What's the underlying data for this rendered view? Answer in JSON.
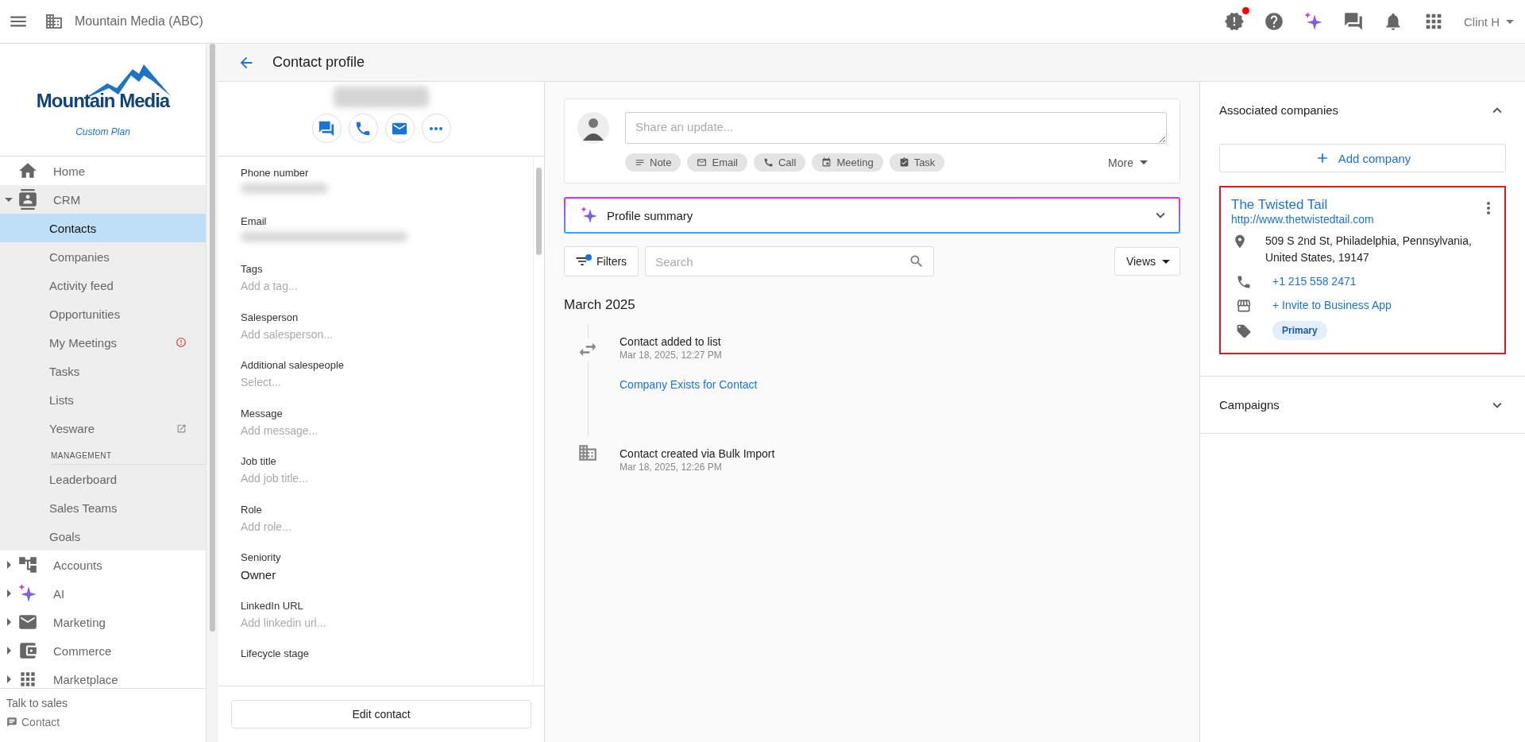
{
  "top_bar": {
    "account": "Mountain Media (ABC)",
    "notification_dot": true,
    "user": "Clint H"
  },
  "sidebar": {
    "logo": "Mountain Media",
    "plan": "Custom Plan",
    "items": [
      {
        "label": "Home"
      },
      {
        "label": "CRM",
        "expanded": true,
        "children": [
          {
            "kind": "link",
            "label": "Contacts",
            "selected": true
          },
          {
            "kind": "link",
            "label": "Companies",
            "selected": false
          },
          {
            "kind": "link",
            "label": "Activity feed",
            "selected": false
          },
          {
            "kind": "link",
            "label": "Opportunities",
            "selected": false
          },
          {
            "kind": "alert",
            "label": "My Meetings",
            "selected": false
          },
          {
            "kind": "link",
            "label": "Tasks",
            "selected": false
          },
          {
            "kind": "link",
            "label": "Lists",
            "selected": false
          },
          {
            "kind": "external",
            "label": "Yesware",
            "selected": false
          },
          {
            "kind": "heading",
            "label": "MANAGEMENT"
          },
          {
            "kind": "link",
            "label": "Leaderboard",
            "selected": false
          },
          {
            "kind": "link",
            "label": "Sales Teams",
            "selected": false
          },
          {
            "kind": "link",
            "label": "Goals",
            "selected": false
          }
        ]
      },
      {
        "label": "Accounts",
        "expanded": false
      },
      {
        "label": "AI",
        "expanded": false
      },
      {
        "label": "Marketing",
        "expanded": false
      },
      {
        "label": "Commerce",
        "expanded": false
      },
      {
        "label": "Marketplace",
        "expanded": false
      }
    ],
    "footer_title": "Talk to sales",
    "footer_link": "Contact"
  },
  "page": {
    "title": "Contact profile"
  },
  "profile": {
    "fields": [
      {
        "label": "Phone number",
        "kind": "blurred"
      },
      {
        "label": "Email",
        "kind": "blurred"
      },
      {
        "label": "Tags",
        "kind": "empty",
        "placeholder": "Add a tag..."
      },
      {
        "label": "Salesperson",
        "kind": "empty",
        "placeholder": "Add salesperson..."
      },
      {
        "label": "Additional salespeople",
        "kind": "empty",
        "placeholder": "Select..."
      },
      {
        "label": "Message",
        "kind": "empty",
        "placeholder": "Add message..."
      },
      {
        "label": "Job title",
        "kind": "empty",
        "placeholder": "Add job title..."
      },
      {
        "label": "Role",
        "kind": "empty",
        "placeholder": "Add role..."
      },
      {
        "label": "Seniority",
        "kind": "value",
        "value": "Owner"
      },
      {
        "label": "LinkedIn URL",
        "kind": "empty",
        "placeholder": "Add linkedin url..."
      },
      {
        "label": "Lifecycle stage",
        "kind": "label"
      }
    ],
    "edit_button": "Edit contact"
  },
  "composer": {
    "placeholder": "Share an update...",
    "actions": [
      "Note",
      "Email",
      "Call",
      "Meeting",
      "Task"
    ],
    "more": "More"
  },
  "summary": {
    "title": "Profile summary",
    "expanded": false
  },
  "filters": {
    "label": "Filters",
    "active": true,
    "search_placeholder": "Search",
    "views": "Views"
  },
  "timeline": {
    "month": "March 2025",
    "events": [
      {
        "kind": "list",
        "title": "Contact added to list",
        "time": "Mar 18, 2025, 12:27 PM",
        "link": "Company Exists for Contact"
      },
      {
        "kind": "created",
        "title": "Contact created via Bulk Import",
        "time": "Mar 18, 2025, 12:26 PM"
      }
    ]
  },
  "associated": {
    "title": "Associated companies",
    "expanded": true,
    "add_label": "Add company",
    "companies": [
      {
        "name": "The Twisted Tail",
        "url": "http://www.thetwistedtail.com",
        "address": "509 S 2nd St, Philadelphia, Pennsylvania, United States, 19147",
        "phone": "+1 215 558 2471",
        "invite": "+ Invite to Business App",
        "tag": "Primary",
        "highlighted": true
      }
    ]
  },
  "campaigns": {
    "title": "Campaigns",
    "expanded": false
  }
}
